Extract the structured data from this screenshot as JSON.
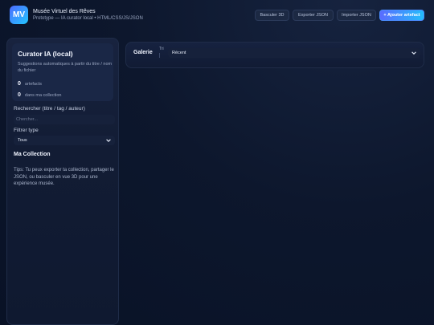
{
  "header": {
    "logo": "MV",
    "title": "Musée Virtuel des Rêves",
    "subtitle": "Prototype — IA curator local • HTML/CSS/JS/JSON",
    "buttons": {
      "vr": "Basculer 3D",
      "export": "Exporter JSON",
      "import": "Importer JSON",
      "add": "+ Ajouter artefact"
    }
  },
  "sidebar": {
    "curator": {
      "title": "Curator IA (local)",
      "description": "Suggestions automatiques à partir du titre / nom du fichier",
      "artifacts_count": "0",
      "artifacts_label": "artefacts",
      "collection_count": "0",
      "collection_label": "dans ma collection"
    },
    "search": {
      "label": "Rechercher (titre / tag / auteur)",
      "placeholder": "Chercher..."
    },
    "filter": {
      "label": "Filtrer type",
      "selected": "Tous"
    },
    "collection_title": "Ma Collection",
    "tips": "Tips: Tu peux exporter ta collection, partager le JSON, ou basculer en vue 3D pour une expérience musée."
  },
  "main": {
    "gallery_title": "Galerie",
    "sort_label": "Tri",
    "sort_selected": "Récent"
  },
  "colors": {
    "accent_start": "#5a6cff",
    "accent_end": "#23bdfb",
    "background": "#0d172d"
  }
}
